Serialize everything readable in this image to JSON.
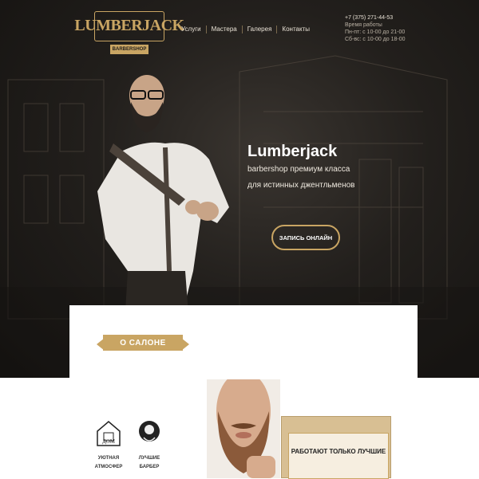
{
  "header": {
    "logo_word": "LUMBERJACK",
    "logo_ribbon": "BARBERSHOP",
    "nav": [
      "Услуги",
      "Мастера",
      "Галерея",
      "Контакты"
    ],
    "phone": "+7 (375) 271-44-53",
    "hours_title": "Время работы",
    "hours_weekdays": "Пн-пт: с 10-00 до 21-00",
    "hours_weekend": "Сб-вс: с 10-00 до 18-00"
  },
  "hero": {
    "title": "Lumberjack",
    "subtitle_1": "barbershop премиум класса",
    "subtitle_2": "для истинных джентльменов",
    "cta": "ЗАПИСЬ ОНЛАЙН"
  },
  "about": {
    "heading": "О САЛОНЕ",
    "features": [
      {
        "icon": "house-icon",
        "label_1": "УЮТНАЯ",
        "label_2": "АТМОСФЕР"
      },
      {
        "icon": "barber-badge-icon",
        "label_1": "ЛУЧШИЕ",
        "label_2": "БАРБЕР"
      }
    ],
    "promo": "РАБОТАЮТ ТОЛЬКО ЛУЧШИЕ"
  },
  "colors": {
    "accent": "#c9a563",
    "dark": "#1a1816"
  }
}
